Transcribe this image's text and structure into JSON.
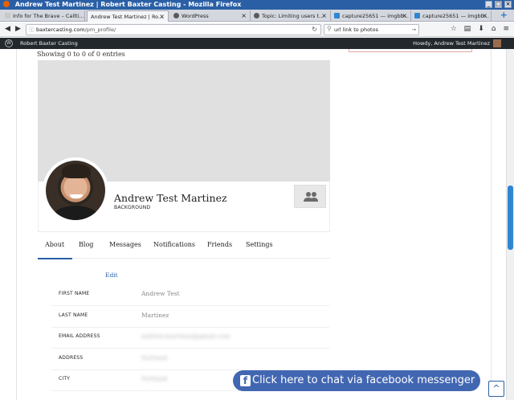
{
  "window": {
    "title": "Andrew Test Martinez | Robert Baxter Casting - Mozilla Firefox",
    "controls": [
      "_",
      "□",
      "×"
    ]
  },
  "tabs": [
    {
      "label": "Info for The Brave – Callti...",
      "favicon_color": "#c8c8c8"
    },
    {
      "label": "Andrew Test Martinez | Ro...",
      "favicon_color": "#ffffff",
      "active": true
    },
    {
      "label": "WordPress",
      "favicon_color": "#5a5a5a"
    },
    {
      "label": "Topic: Limiting users t...",
      "favicon_color": "#5a5a5a"
    },
    {
      "label": "capture25651 — imgbb...",
      "favicon_color": "#2f86d2"
    },
    {
      "label": "capture25651 — imgbb...",
      "favicon_color": "#2f86d2"
    }
  ],
  "tab_close": "×",
  "newtab": "+",
  "nav": {
    "back": "◀",
    "forward": "▶",
    "info": "ⓘ",
    "url_domain": "baxtercasting.com",
    "url_path": "/pm_profile/",
    "reload": "↻",
    "search_value": "url link to photos",
    "search_go": "→",
    "icons": [
      "☆",
      "▤",
      "⬇",
      "⌂",
      "≡"
    ]
  },
  "adminbar": {
    "wp_logo": "W",
    "site_name": "Robert Baxter Casting",
    "howdy": "Howdy, Andrew Test Martinez"
  },
  "main": {
    "entries_text": "Showing 0 to 0 of 0 entries",
    "profile_name": "Andrew Test Martinez",
    "profile_tag": "BACKGROUND",
    "tabs": [
      "About",
      "Blog",
      "Messages",
      "Notifications",
      "Friends",
      "Settings"
    ],
    "edit_label": "Edit",
    "fields": [
      {
        "label": "FIRST NAME",
        "value": "Andrew Test"
      },
      {
        "label": "LAST NAME",
        "value": "Martinez"
      },
      {
        "label": "EMAIL ADDRESS",
        "value": "andrew.martinez@gmail.com"
      },
      {
        "label": "ADDRESS",
        "value": "Portland"
      },
      {
        "label": "CITY",
        "value": "Portland"
      }
    ]
  },
  "chat": {
    "fb_letter": "f",
    "label": "Click here to chat via facebook messenger"
  },
  "back_to_top": "^",
  "colors": {
    "accent": "#2a5fa6",
    "fb": "#4267b2",
    "adminbar": "#23282d"
  }
}
